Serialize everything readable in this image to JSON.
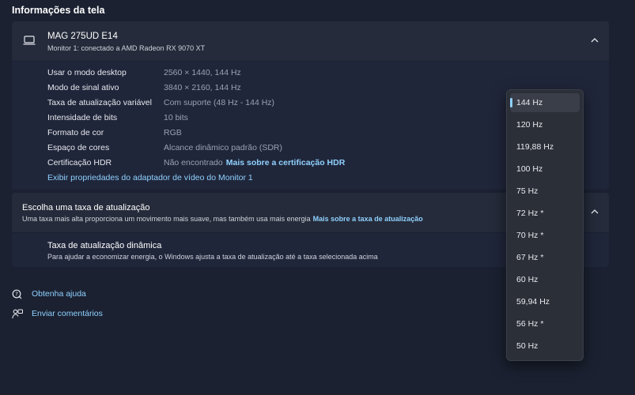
{
  "page": {
    "section_title": "Informações da tela"
  },
  "monitor": {
    "name": "MAG 275UD E14",
    "subtitle": "Monitor 1: conectado a AMD Radeon RX 9070 XT",
    "rows": [
      {
        "label": "Usar o modo desktop",
        "value": "2560 × 1440, 144 Hz"
      },
      {
        "label": "Modo de sinal ativo",
        "value": "3840 × 2160, 144 Hz"
      },
      {
        "label": "Taxa de atualização variável",
        "value": "Com suporte (48 Hz - 144 Hz)"
      },
      {
        "label": "Intensidade de bits",
        "value": "10 bits"
      },
      {
        "label": "Formato de cor",
        "value": "RGB"
      },
      {
        "label": "Espaço de cores",
        "value": "Alcance dinâmico padrão (SDR)"
      },
      {
        "label": "Certificação HDR",
        "value": "Não encontrado",
        "link": "Mais sobre a certificação HDR"
      }
    ],
    "adapter_link": "Exibir propriedades do adaptador de vídeo do Monitor 1"
  },
  "refresh": {
    "title": "Escolha uma taxa de atualização",
    "description": "Uma taxa mais alta proporciona um movimento mais suave, mas também usa mais energia",
    "learn_more": "Mais sobre a taxa de atualização",
    "dynamic_title": "Taxa de atualização dinâmica",
    "dynamic_description": "Para ajudar a economizar energia, o Windows ajusta a taxa de atualização até a taxa selecionada acima"
  },
  "help": {
    "get_help": "Obtenha ajuda",
    "feedback": "Enviar comentários"
  },
  "dropdown": {
    "selected": "144 Hz",
    "options": [
      "144 Hz",
      "120 Hz",
      "119,88 Hz",
      "100 Hz",
      "75 Hz",
      "72 Hz *",
      "70 Hz *",
      "67 Hz *",
      "60 Hz",
      "59,94 Hz",
      "56 Hz *",
      "50 Hz"
    ]
  },
  "colors": {
    "background": "#1b2131",
    "card": "#252b3a",
    "link": "#8fd1ff",
    "dropdown_bg": "#2b2f38"
  },
  "icons": {
    "monitor": "laptop-icon",
    "expand": "chevron-up-icon",
    "help": "help-chat-icon",
    "feedback": "feedback-icon"
  }
}
